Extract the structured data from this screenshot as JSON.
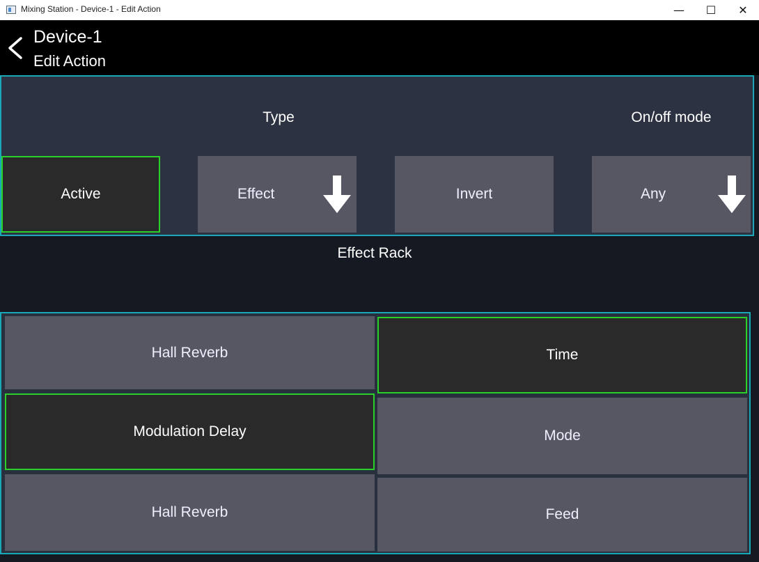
{
  "window": {
    "title": "Mixing Station - Device-1 - Edit Action",
    "minimize": "—",
    "maximize": "☐",
    "close": "✕"
  },
  "header": {
    "title": "Device-1",
    "subtitle": "Edit Action"
  },
  "top": {
    "type_label": "Type",
    "onoff_label": "On/off mode",
    "active_label": "Active",
    "effect_label": "Effect",
    "invert_label": "Invert",
    "any_label": "Any"
  },
  "section_label": "Effect Rack",
  "rack": {
    "left": [
      "Hall Reverb",
      "Modulation Delay",
      "Hall Reverb"
    ],
    "right": [
      "Time",
      "Mode",
      "Feed"
    ]
  },
  "colors": {
    "selected_border": "#2ad12a",
    "panel_border": "#1aa8b8",
    "button_bg": "#575763"
  }
}
